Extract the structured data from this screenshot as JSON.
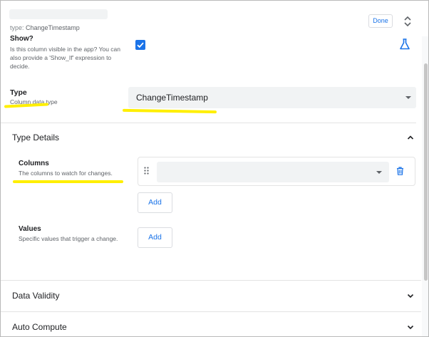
{
  "header": {
    "type_prefix": "type:",
    "type_value": "ChangeTimestamp",
    "done_label": "Done"
  },
  "show": {
    "title": "Show?",
    "description": "Is this column visible in the app? You can also provide a 'Show_If' expression to decide.",
    "checked": true
  },
  "type": {
    "title": "Type",
    "description": "Column data type",
    "selected": "ChangeTimestamp"
  },
  "type_details": {
    "title": "Type Details",
    "expanded": true,
    "columns": {
      "title": "Columns",
      "description": "The columns to watch for changes.",
      "selected": "",
      "add_label": "Add"
    },
    "values": {
      "title": "Values",
      "description": "Specific values that trigger a change.",
      "add_label": "Add"
    }
  },
  "sections": [
    {
      "title": "Data Validity",
      "expanded": false
    },
    {
      "title": "Auto Compute",
      "expanded": false
    }
  ],
  "colors": {
    "accent": "#1a73e8",
    "highlight": "#ffef00"
  },
  "icons": [
    "expand-collapse-icon",
    "flask-icon",
    "dropdown-arrow-icon",
    "chevron-up-icon",
    "drag-handle-icon",
    "delete-icon",
    "chevron-down-icon"
  ]
}
